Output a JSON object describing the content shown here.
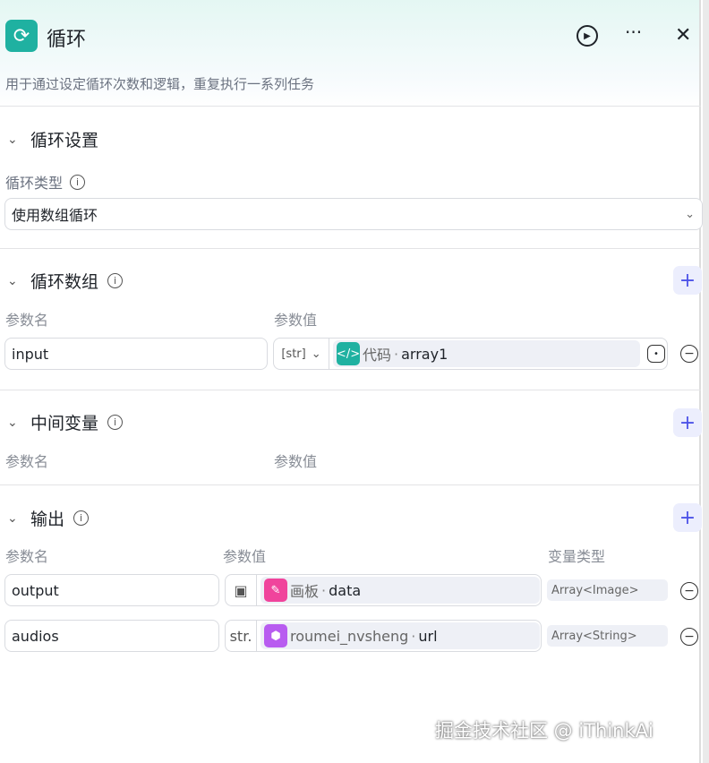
{
  "header": {
    "title": "循环",
    "description": "用于通过设定循环次数和逻辑，重复执行一系列任务"
  },
  "loop_settings": {
    "title": "循环设置",
    "type_label": "循环类型",
    "type_value": "使用数组循环"
  },
  "loop_array": {
    "title": "循环数组",
    "col_name": "参数名",
    "col_value": "参数值",
    "rows": [
      {
        "name": "input",
        "type_tag": "[str]",
        "source": "代码",
        "field": "array1"
      }
    ]
  },
  "intermediate": {
    "title": "中间变量",
    "col_name": "参数名",
    "col_value": "参数值"
  },
  "output": {
    "title": "输出",
    "col_name": "参数名",
    "col_value": "参数值",
    "col_type": "变量类型",
    "rows": [
      {
        "name": "output",
        "source": "画板",
        "field": "data",
        "var_type": "Array<Image>"
      },
      {
        "name": "audios",
        "type_tag": "str.",
        "source": "roumei_nvsheng",
        "field": "url",
        "var_type": "Array<String>"
      }
    ]
  },
  "separator": "·",
  "watermark": "掘金技术社区 @ iThinkAi",
  "colors": {
    "accent": "#4d53e8",
    "node_teal": "#1fb1a1",
    "board_pink": "#f0449c",
    "plugin_purple": "#b85cf0"
  }
}
